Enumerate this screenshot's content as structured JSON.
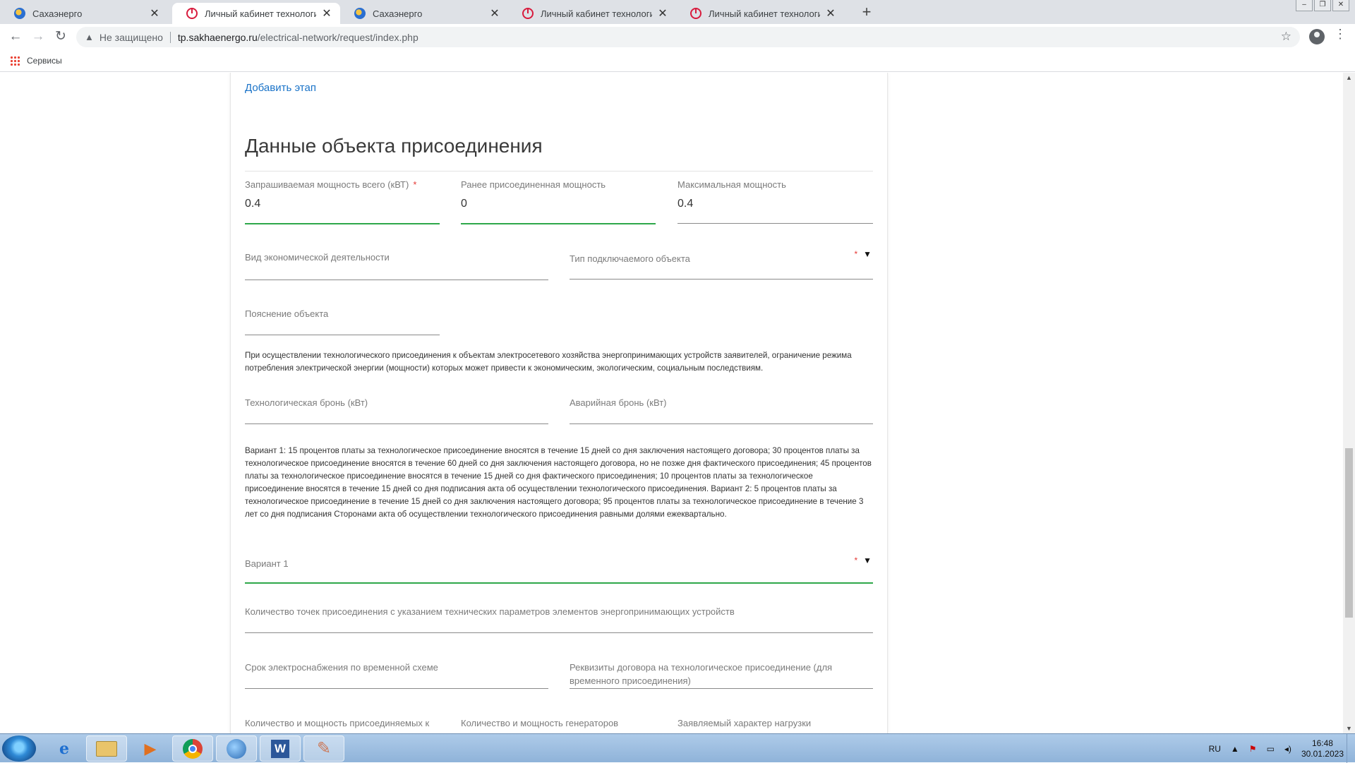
{
  "browser": {
    "tabs": [
      {
        "title": "Сахаэнерго",
        "icon": "globe-icon",
        "active": false
      },
      {
        "title": "Личный кабинет технологическ",
        "icon": "power-icon",
        "active": true
      },
      {
        "title": "Сахаэнерго",
        "icon": "globe-icon",
        "active": false
      },
      {
        "title": "Личный кабинет технологическ",
        "icon": "power-icon",
        "active": false
      },
      {
        "title": "Личный кабинет технологическ",
        "icon": "power-icon",
        "active": false
      }
    ],
    "new_tab": "+",
    "close_glyph": "✕",
    "security_text": "Не защищено",
    "url_host": "tp.sakhaenergo.ru",
    "url_path": "/electrical-network/request/index.php",
    "bookmarks": [
      {
        "label": "Сервисы"
      }
    ]
  },
  "page": {
    "add_stage_link": "Добавить этап",
    "section_title": "Данные объекта присоединения",
    "required_mark": "*",
    "dropdown_arrow": "▼",
    "requested_power": {
      "label": "Запрашиваемая мощность всего (кВТ)",
      "value": "0.4"
    },
    "previous_power": {
      "label": "Ранее присоединенная мощность",
      "value": "0"
    },
    "max_power": {
      "label": "Максимальная мощность",
      "value": "0.4"
    },
    "economic_activity": {
      "label": "Вид экономической деятельности"
    },
    "object_type": {
      "label": "Тип подключаемого объекта"
    },
    "object_explanation": {
      "label": "Пояснение объекта"
    },
    "note_restriction": "При осуществлении технологического присоединения к объектам электросетевого хозяйства энергопринимающих устройств заявителей, ограничение режима потребления электрической энергии (мощности) которых может привести к экономическим, экологическим, социальным последствиям.",
    "tech_reserve": {
      "label": "Технологическая бронь (кВт)"
    },
    "emergency_reserve": {
      "label": "Аварийная бронь (кВт)"
    },
    "note_payment": "Вариант 1: 15 процентов платы за технологическое присоединение вносятся в течение 15 дней со дня заключения настоящего договора; 30 процентов платы за технологическое присоединение вносятся в течение 60 дней со дня заключения настоящего договора, но не позже дня фактического присоединения; 45 процентов платы за технологическое присоединение вносятся в течение 15 дней со дня фактического присоединения; 10 процентов платы за технологическое присоединение вносятся в течение 15 дней со дня подписания акта об осуществлении технологического присоединения. Вариант 2: 5 процентов платы за технологическое присоединение в течение 15 дней со дня заключения настоящего договора; 95 процентов платы за технологическое присоединение в течение 3 лет со дня подписания Сторонами акта об осуществлении технологического присоединения равными долями ежеквартально.",
    "payment_variant": {
      "label": "Вариант 1"
    },
    "connection_points": {
      "label": "Количество точек присоединения с указанием технических параметров элементов энергопринимающих устройств"
    },
    "temp_supply_period": {
      "label": "Срок электроснабжения по временной схеме"
    },
    "contract_details": {
      "label": "Реквизиты договора на технологическое присоединение (для временного присоединения)"
    },
    "connected_devices": {
      "label": "Количество и мощность присоединяемых к"
    },
    "generators": {
      "label": "Количество и мощность генераторов"
    },
    "load_character": {
      "label": "Заявляемый характер нагрузки"
    }
  },
  "taskbar": {
    "language": "RU",
    "time": "16:48",
    "date": "30.01.2023"
  }
}
